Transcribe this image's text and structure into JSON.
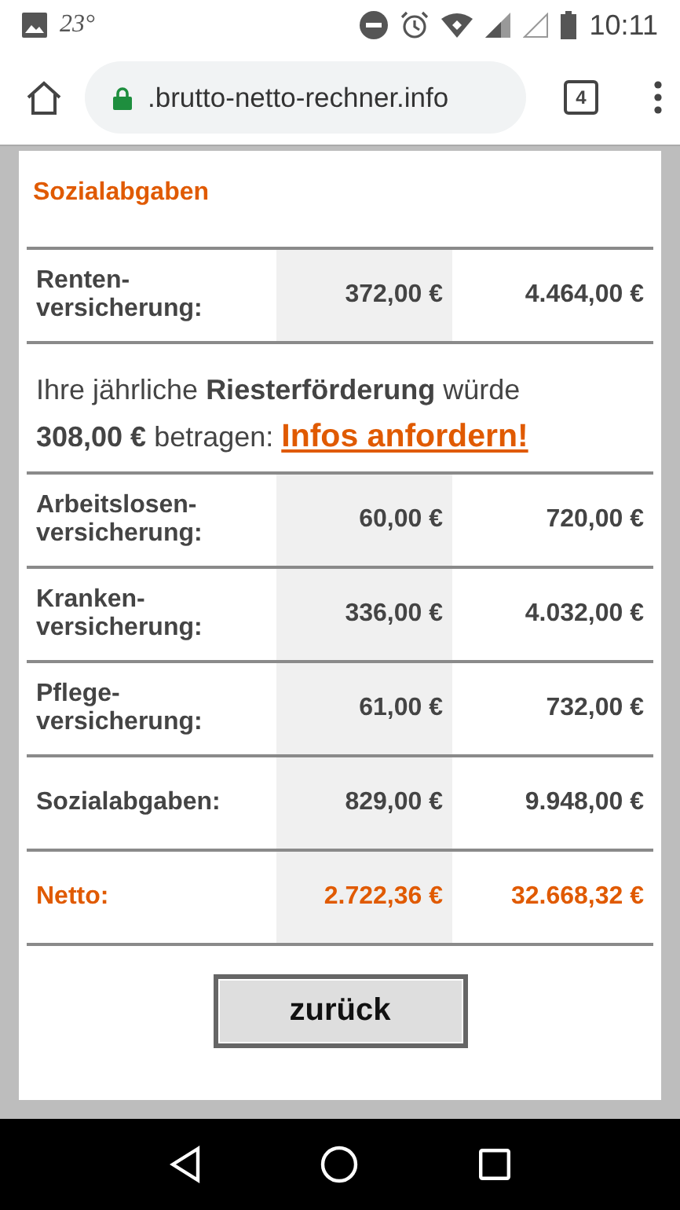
{
  "status_bar": {
    "temperature": "23°",
    "time": "10:11"
  },
  "browser": {
    "url": ".brutto-netto-rechner.info",
    "tab_count": "4"
  },
  "section": {
    "title": "Sozialabgaben"
  },
  "rows": [
    {
      "kind": "row",
      "label": "Renten-versicherung:",
      "monthly": "372,00 €",
      "yearly": "4.464,00 €"
    },
    {
      "kind": "info",
      "text": "Ihre jährliche **Riesterförderung** würde **308,00 €** betragen:",
      "link": "Infos anfordern!"
    },
    {
      "kind": "row",
      "label": "Arbeitslosen-versicherung:",
      "monthly": "60,00 €",
      "yearly": "720,00 €"
    },
    {
      "kind": "row",
      "label": "Kranken-versicherung:",
      "monthly": "336,00 €",
      "yearly": "4.032,00 €"
    },
    {
      "kind": "row",
      "label": "Pflege-versicherung:",
      "monthly": "61,00 €",
      "yearly": "732,00 €"
    },
    {
      "kind": "row",
      "label": "Sozialabgaben:",
      "monthly": "829,00 €",
      "yearly": "9.948,00 €"
    },
    {
      "kind": "result",
      "label": "Netto:",
      "monthly": "2.722,36 €",
      "yearly": "32.668,32 €"
    }
  ],
  "back_button": "zurück"
}
